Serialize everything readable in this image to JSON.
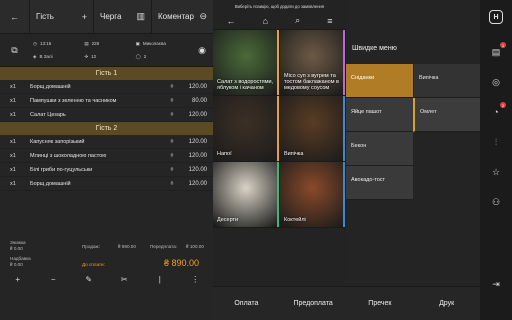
{
  "topbar": {
    "guest_label": "Гість",
    "queue_label": "Черга",
    "comment_label": "Коментар"
  },
  "info": {
    "time": "13:15",
    "check_no": "228",
    "waiter": "Миколаєва",
    "zone": "В Залі",
    "guests": "12",
    "count": "2"
  },
  "guests": [
    {
      "title": "Гість 1",
      "rows": [
        {
          "qty": "x1",
          "name": "Борщ домашній",
          "price": "120.00"
        },
        {
          "qty": "x1",
          "name": "Пампушки з зеленню та часником",
          "price": "80.00"
        },
        {
          "qty": "x1",
          "name": "Салат Цезарь",
          "price": "120.00"
        }
      ]
    },
    {
      "title": "Гість 2",
      "rows": [
        {
          "qty": "x1",
          "name": "Капусняк запорізький",
          "price": "120.00"
        },
        {
          "qty": "x1",
          "name": "Млинці з шоколадною пастою",
          "price": "120.00"
        },
        {
          "qty": "x1",
          "name": "Білі гриби по-гуцульськи",
          "price": "120.00"
        },
        {
          "qty": "x1",
          "name": "Борщ домашній",
          "price": "120.00"
        }
      ]
    }
  ],
  "totals": {
    "discount_label": "Знижка",
    "discount_value": "₴ 0.00",
    "surcharge_label": "Надбавка",
    "surcharge_value": "₴ 0.00",
    "paid_label": "Продаж:",
    "paid_value": "₴ 890.00",
    "prepaid_label": "Передплата:",
    "prepaid_value": "₴ 100.00",
    "to_pay_label": "До сплати:",
    "to_pay_value": "₴ 890.00"
  },
  "actions": [
    "+",
    "−",
    "✎",
    "✂",
    "|",
    "⋮"
  ],
  "mid": {
    "hint": "Виберіть позицію, щоб додати до замовлення",
    "tiles": [
      {
        "label": "Салат з водоростями, яблуком і качаном",
        "color": "#4a6b3a",
        "accent": "#e8a13a"
      },
      {
        "label": "Місо суп з вугрем та тостом баклажаном в медовому соусом",
        "color": "#6d5a46",
        "accent": "#b56ad8"
      },
      {
        "label": "Напої",
        "color": "#3d3025",
        "accent": "#e8a13a"
      },
      {
        "label": "Випічка",
        "color": "#5a3c24",
        "accent": "#3a8ad8"
      },
      {
        "label": "Десерти",
        "color": "#d9d3c6",
        "accent": "#3ab878"
      },
      {
        "label": "Коктейлі",
        "color": "#8a4a2a",
        "accent": "#3a8ad8"
      }
    ]
  },
  "menu": {
    "title": "Швидке меню",
    "categories": [
      "Сніданки",
      "Яйце пашот",
      "Бекон",
      "Авокадо-тост"
    ],
    "items": [
      "Випічка",
      "Омлет"
    ]
  },
  "bottom": [
    "Оплата",
    "Предоплата",
    "Пречек",
    "Друк"
  ],
  "sidebar": {
    "logo": "H",
    "badge1": "1",
    "badge2": "2"
  }
}
